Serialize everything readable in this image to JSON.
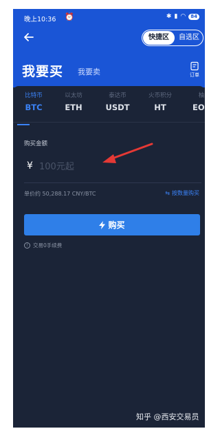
{
  "status_bar": {
    "time": "晚上10:36",
    "alarm_icon": "alarm-icon",
    "battery": "84",
    "icons": [
      "bluetooth-icon",
      "signal-icon",
      "wifi-icon",
      "battery-icon"
    ]
  },
  "header": {
    "back_icon": "arrow-left-icon",
    "mode_active": "快捷区",
    "mode_inactive": "自选区",
    "title_buy": "我要买",
    "title_sell": "我要卖",
    "orders_label": "订单",
    "orders_icon": "orders-icon"
  },
  "tabs": [
    {
      "sub": "比特币",
      "code": "BTC",
      "active": true
    },
    {
      "sub": "以太坊",
      "code": "ETH",
      "active": false
    },
    {
      "sub": "泰达币",
      "code": "USDT",
      "active": false
    },
    {
      "sub": "火币积分",
      "code": "HT",
      "active": false
    },
    {
      "sub": "柚",
      "code": "EOS",
      "active": false
    }
  ],
  "form": {
    "amount_label": "购买金额",
    "currency_symbol": "¥",
    "amount_placeholder": "100元起",
    "unit_price": "单价约 50,288.17 CNY/BTC",
    "by_quantity": "按数量购买",
    "buy_button": "购买",
    "fee_note": "交易0手续费"
  },
  "colors": {
    "header_blue": "#1a55d6",
    "panel_dark": "#1b2437",
    "accent_blue": "#3b82f6",
    "button_blue": "#2f7fe8",
    "annotation_red": "#e53935"
  },
  "watermark": "知乎 @西安交易员"
}
